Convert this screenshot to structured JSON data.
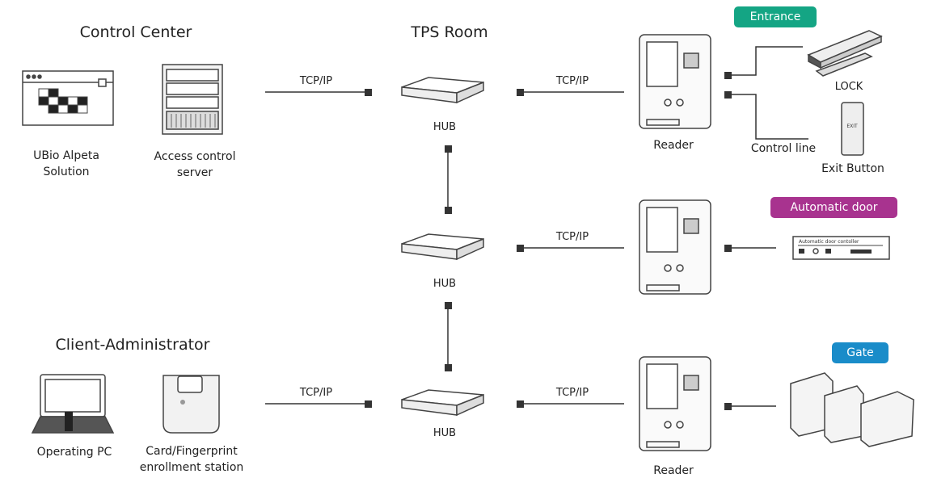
{
  "sections": {
    "control_center": "Control Center",
    "tps_room": "TPS Room",
    "client_admin": "Client-Administrator"
  },
  "devices": {
    "alpeta": [
      "UBio Alpeta",
      "Solution"
    ],
    "server": [
      "Access control",
      "server"
    ],
    "pc": "Operating PC",
    "enroll": [
      "Card/Fingerprint",
      "enrollment station"
    ],
    "hub": "HUB",
    "reader": "Reader",
    "lock": "LOCK",
    "exit_button": "Exit Button",
    "control_line": "Control line",
    "door_controller": "Automatic door contoller",
    "exit_label": "EXIT"
  },
  "links": {
    "tcpip": "TCP/IP"
  },
  "badges": [
    {
      "label": "Entrance",
      "color": "#14a584"
    },
    {
      "label": "Automatic door",
      "color": "#a8338f"
    },
    {
      "label": "Gate",
      "color": "#1a8cc9"
    }
  ]
}
